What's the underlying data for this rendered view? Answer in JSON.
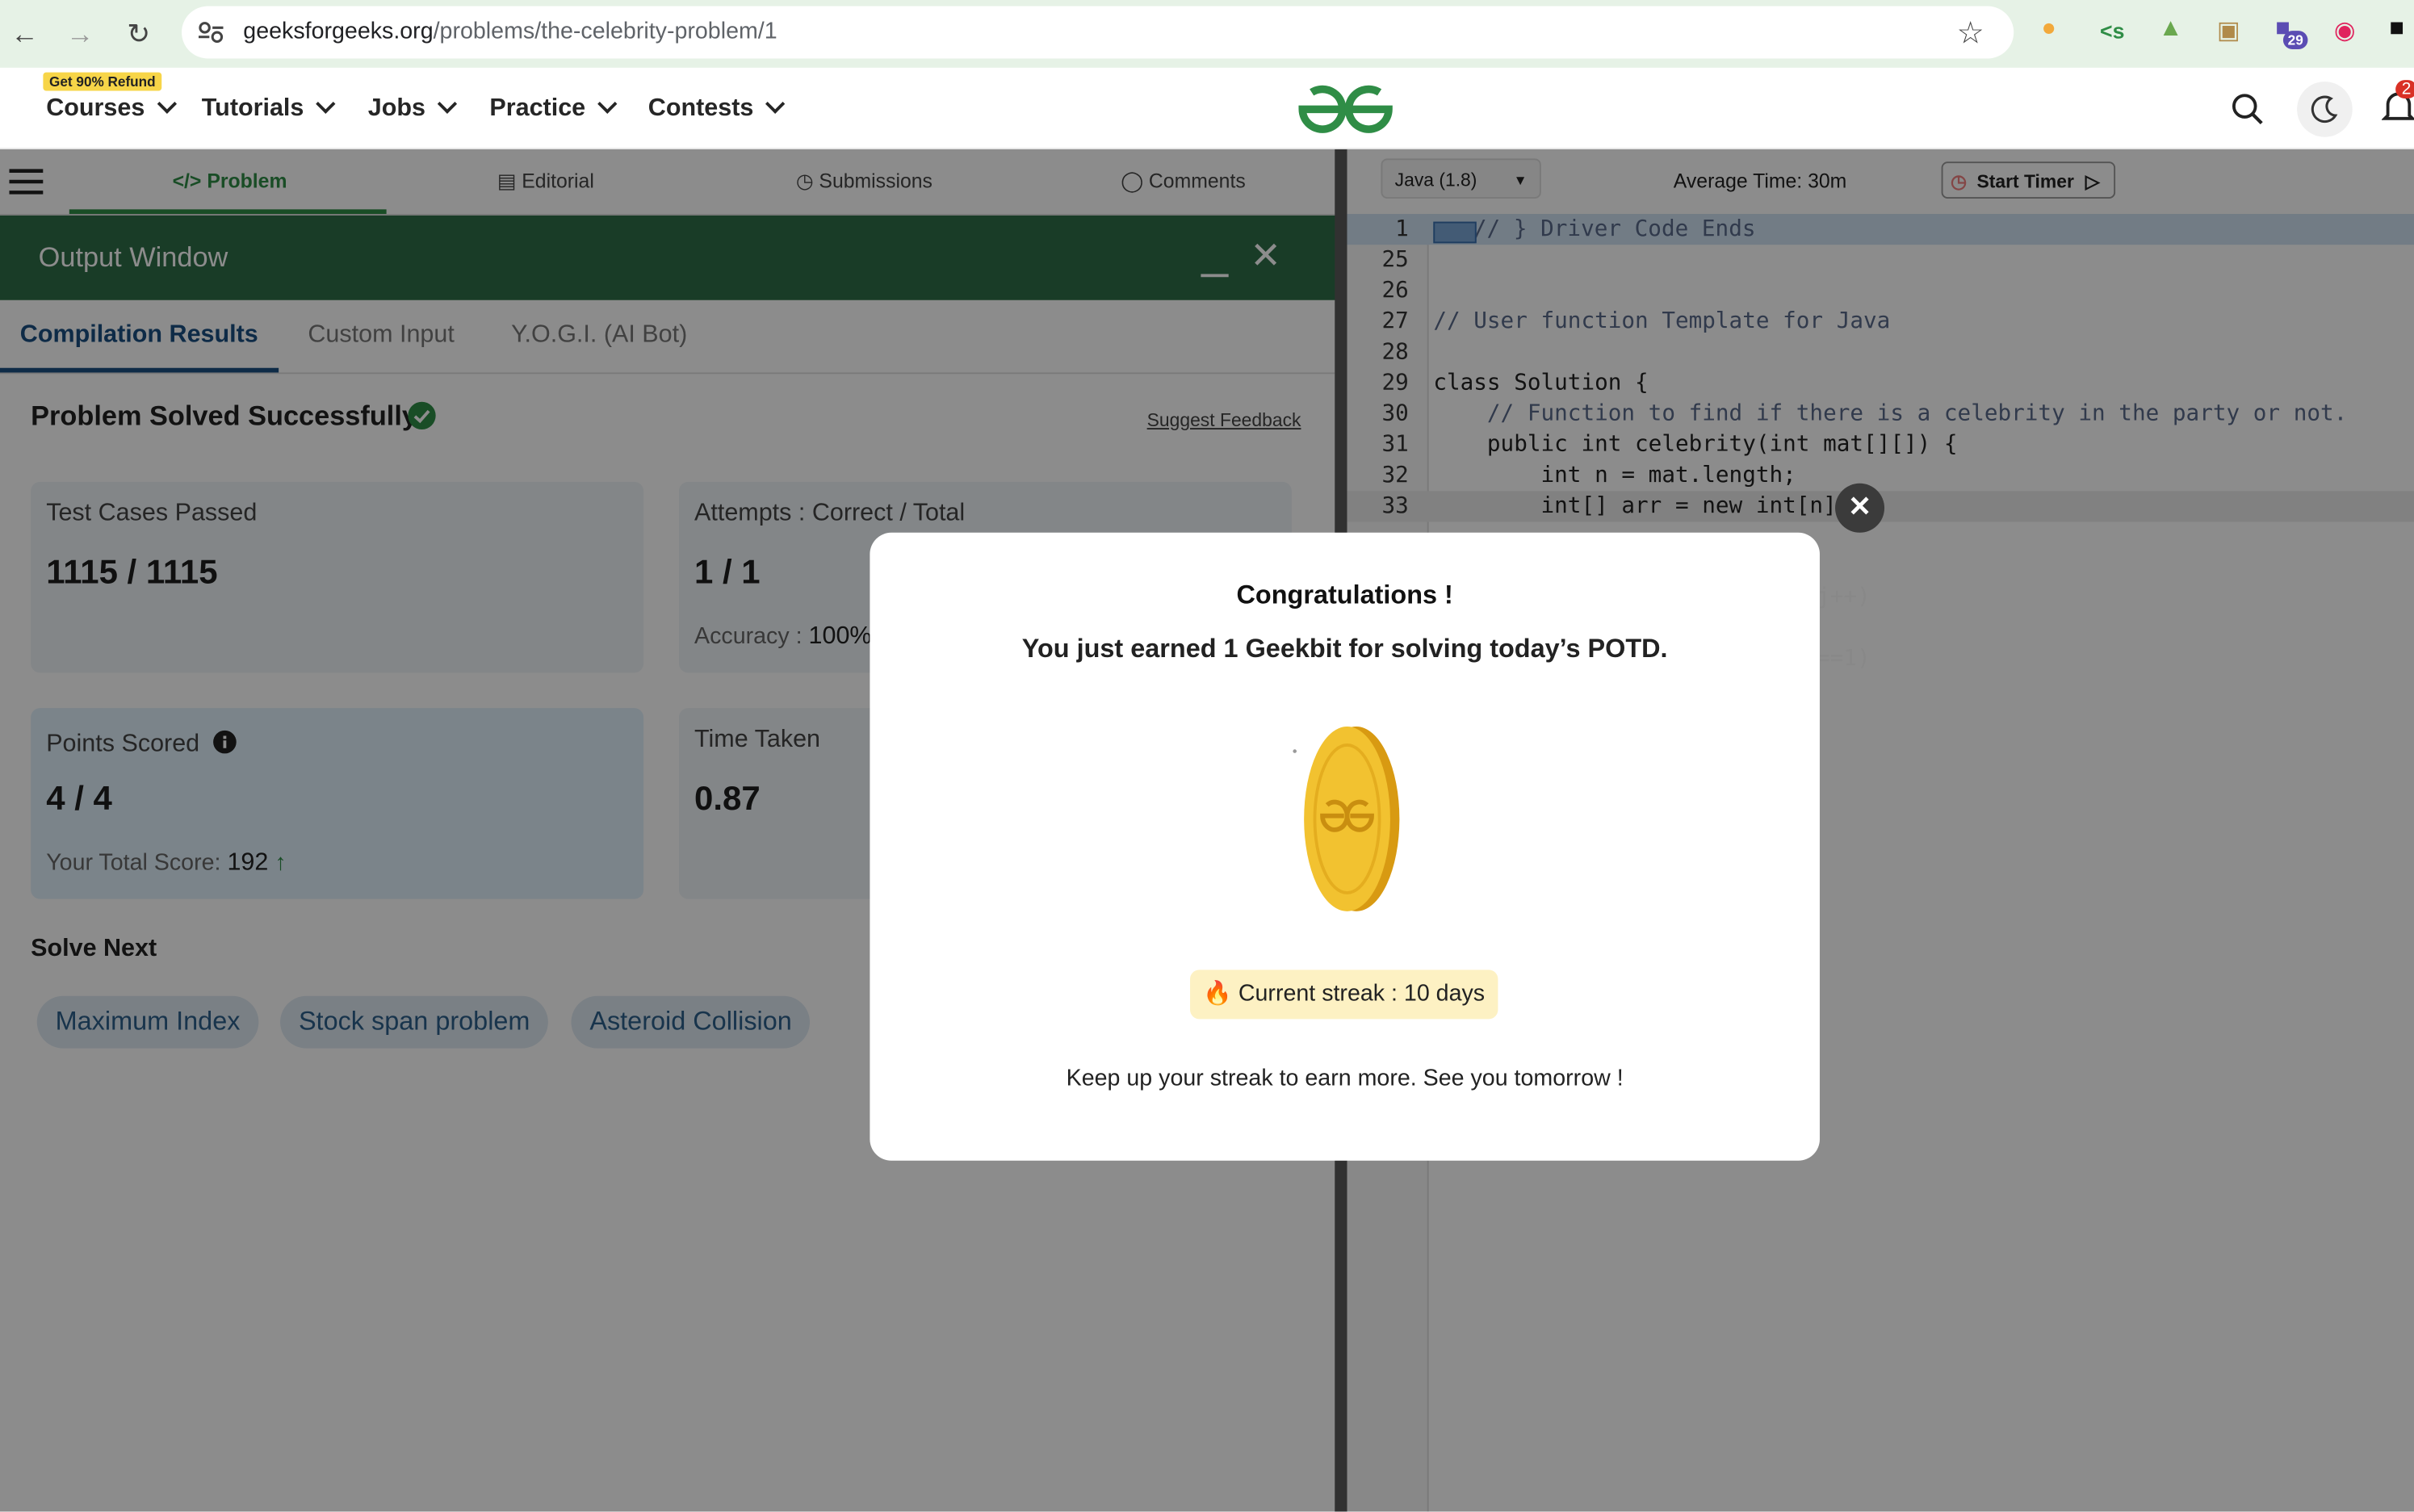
{
  "browser": {
    "url_domain": "geeksforgeeks.org",
    "url_path": "/problems/the-celebrity-problem/1",
    "extension_badge": "29"
  },
  "header": {
    "refund_badge": "Get 90% Refund",
    "menus": [
      "Courses",
      "Tutorials",
      "Jobs",
      "Practice",
      "Contests"
    ],
    "notification_badge": "2"
  },
  "problem_tabs": {
    "problem": "Problem",
    "editorial": "Editorial",
    "submissions": "Submissions",
    "comments": "Comments"
  },
  "output_window": {
    "title": "Output Window",
    "tabs": [
      "Compilation Results",
      "Custom Input",
      "Y.O.G.I. (AI Bot)"
    ],
    "status": "Problem Solved Successfully",
    "suggest_feedback": "Suggest Feedback",
    "cards": {
      "test_cases": {
        "label": "Test Cases Passed",
        "value": "1115 / 1115"
      },
      "attempts": {
        "label": "Attempts : Correct / Total",
        "value": "1 / 1",
        "sub_label": "Accuracy :",
        "sub_value": "100%"
      },
      "points": {
        "label": "Points Scored",
        "value": "4 / 4",
        "sub_label": "Your Total Score:",
        "sub_value": "192"
      },
      "time": {
        "label": "Time Taken",
        "value": "0.87"
      }
    },
    "solve_next_label": "Solve Next",
    "solve_next": [
      "Maximum Index",
      "Stock span problem",
      "Asteroid Collision"
    ]
  },
  "editor": {
    "language": "Java (1.8)",
    "average_time": "Average Time: 30m",
    "start_timer": "Start Timer",
    "lines": [
      {
        "num": "1",
        "text": "// } Driver Code Ends"
      },
      {
        "num": "25",
        "text": ""
      },
      {
        "num": "26",
        "text": ""
      },
      {
        "num": "27",
        "text": "// User function Template for Java"
      },
      {
        "num": "28",
        "text": ""
      },
      {
        "num": "29",
        "text": "class Solution {"
      },
      {
        "num": "30",
        "text": "    // Function to find if there is a celebrity in the party or not."
      },
      {
        "num": "31",
        "text": "    public int celebrity(int mat[][]) {"
      },
      {
        "num": "32",
        "text": "        int n = mat.length;"
      },
      {
        "num": "33",
        "text": "        int[] arr = new int[n];"
      }
    ],
    "partial_fragments": [
      "j++)",
      "==1)",
      ";",
      ";"
    ]
  },
  "modal": {
    "title": "Congratulations !",
    "subtitle": "You just earned 1 Geekbit for solving today’s POTD.",
    "streak": "🔥 Current streak : 10 days",
    "footer": "Keep up your streak to earn more. See you tomorrow !"
  },
  "colors": {
    "brand_green": "#2f8d46",
    "output_header": "#2f6e47",
    "coin": "#f2c230",
    "streak_bg": "#fdf1c3"
  }
}
